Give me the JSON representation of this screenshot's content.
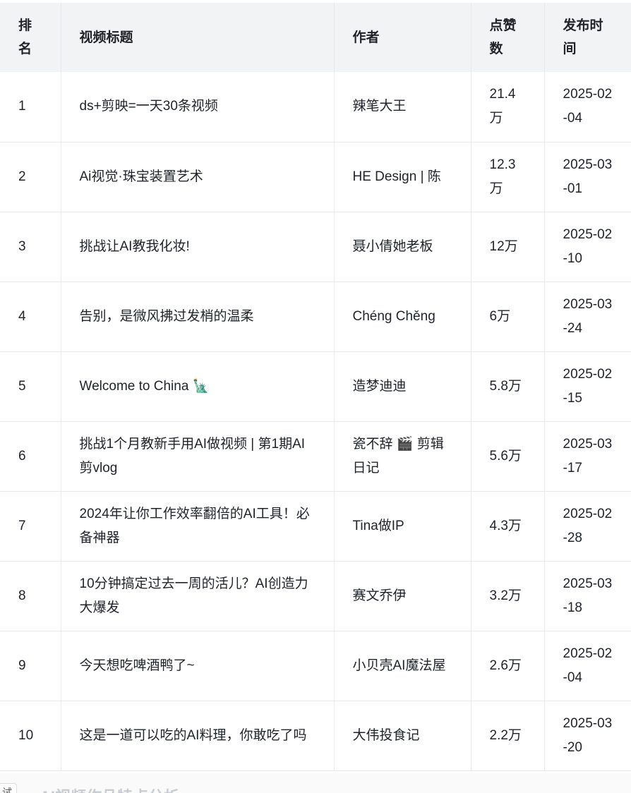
{
  "table": {
    "headers": [
      "排名",
      "视频标题",
      "作者",
      "点赞数",
      "发布时间"
    ],
    "rows": [
      [
        "1",
        "ds+剪映=一天30条视频",
        "辣笔大王",
        "21.4万",
        "2025-02-04"
      ],
      [
        "2",
        "Ai视觉·珠宝装置艺术",
        "HE Design | 陈",
        "12.3万",
        "2025-03-01"
      ],
      [
        "3",
        "挑战让AI教我化妆!",
        "聂小倩她老板",
        "12万",
        "2025-02-10"
      ],
      [
        "4",
        "告别，是微风拂过发梢的温柔",
        "Chéng Chěng",
        "6万",
        "2025-03-24"
      ],
      [
        "5",
        "Welcome to China 🗽",
        "造梦迪迪",
        "5.8万",
        "2025-02-15"
      ],
      [
        "6",
        "挑战1个月教新手用AI做视频 | 第1期AI剪vlog",
        "瓷不辞 🎬 剪辑日记",
        "5.6万",
        "2025-03-17"
      ],
      [
        "7",
        "2024年让你工作效率翻倍的AI工具！必备神器",
        "Tina做IP",
        "4.3万",
        "2025-02-28"
      ],
      [
        "8",
        "10分钟搞定过去一周的活儿？AI创造力大爆发",
        "赛文乔伊",
        "3.2万",
        "2025-03-18"
      ],
      [
        "9",
        "今天想吃啤酒鸭了~",
        "小贝壳AI魔法屋",
        "2.6万",
        "2025-02-04"
      ],
      [
        "10",
        "这是一道可以吃的AI料理，你敢吃了吗",
        "大伟投食记",
        "2.2万",
        "2025-03-20"
      ]
    ]
  },
  "bottom": {
    "label": "试",
    "heading": "AI视频作品特点分析"
  }
}
